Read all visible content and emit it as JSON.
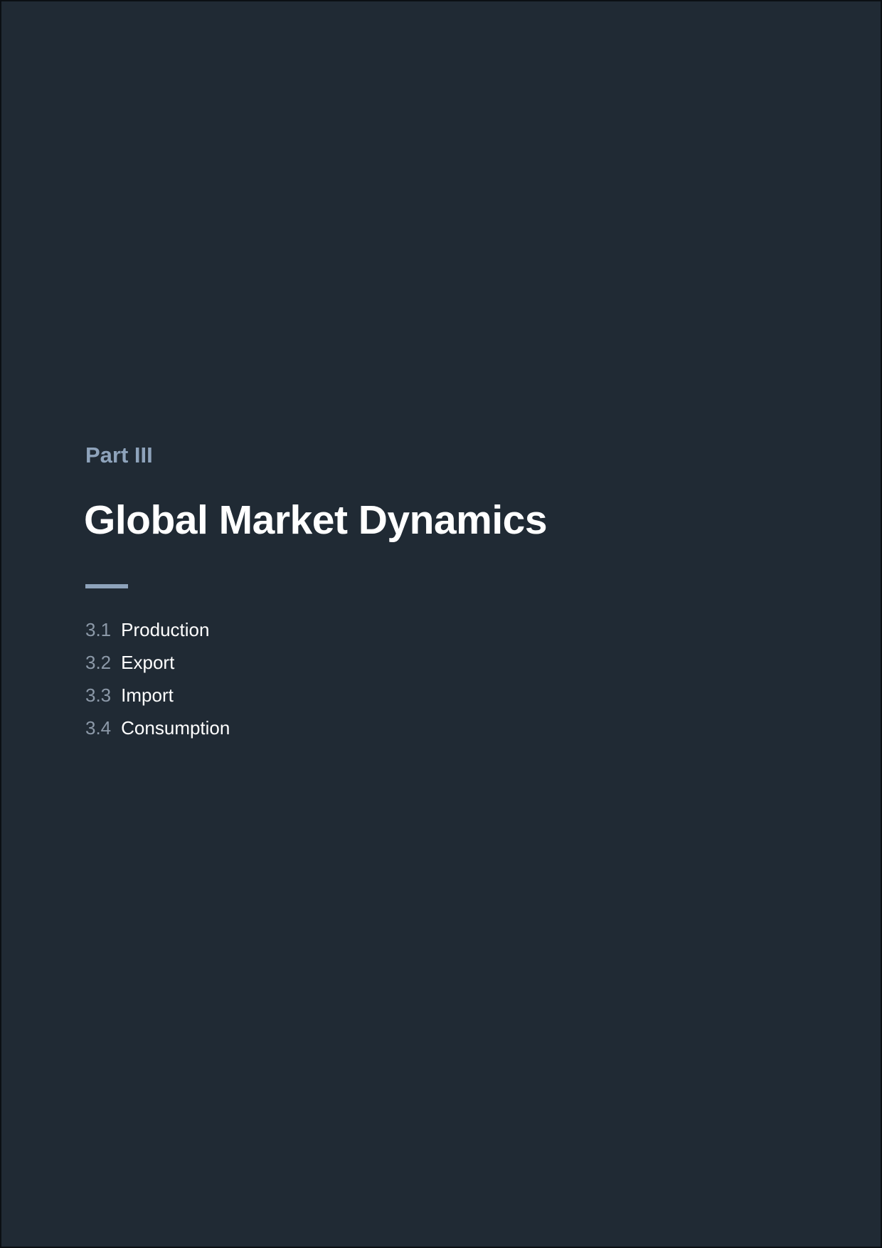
{
  "part": {
    "label": "Part III"
  },
  "title": "Global Market Dynamics",
  "toc": [
    {
      "number": "3.1",
      "label": "Production"
    },
    {
      "number": "3.2",
      "label": "Export"
    },
    {
      "number": "3.3",
      "label": "Import"
    },
    {
      "number": "3.4",
      "label": "Consumption"
    }
  ],
  "colors": {
    "background": "#202a34",
    "accent": "#8ea3bb",
    "title": "#ffffff",
    "number": "#8c99a8"
  }
}
